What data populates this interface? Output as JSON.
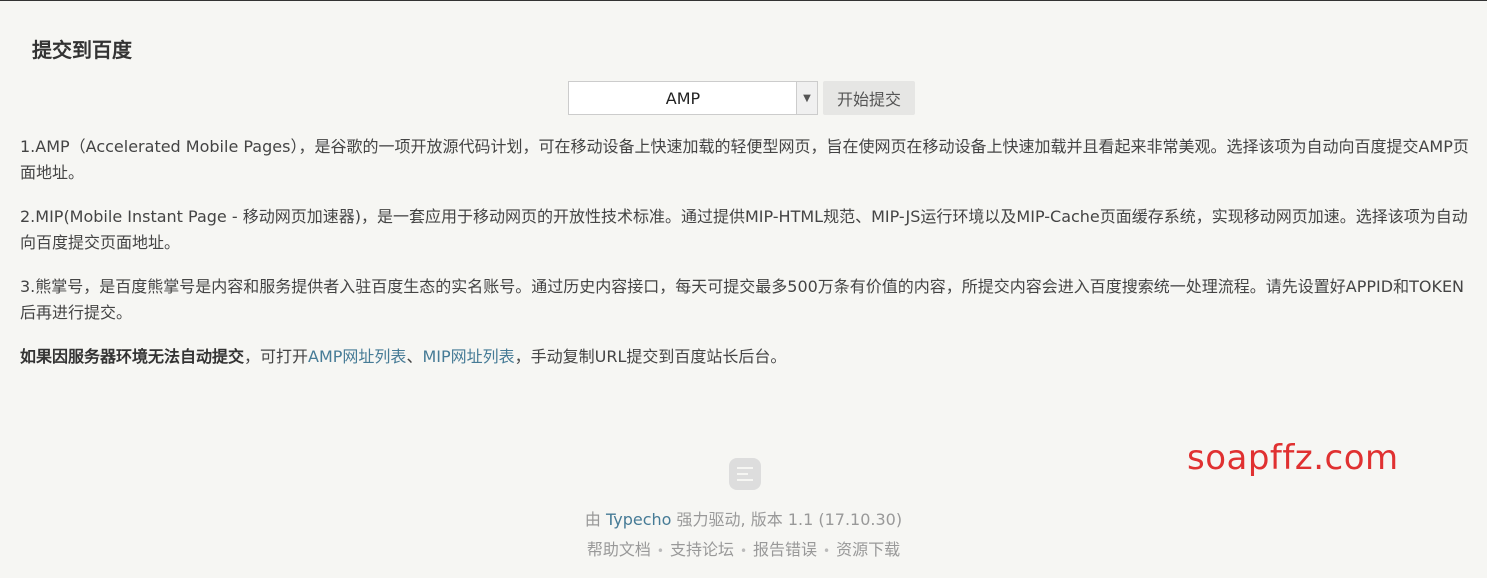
{
  "page": {
    "title": "提交到百度"
  },
  "form": {
    "selected_type": "AMP",
    "submit_label": "开始提交"
  },
  "content": {
    "p1": "1.AMP（Accelerated Mobile Pages），是谷歌的一项开放源代码计划，可在移动设备上快速加载的轻便型网页，旨在使网页在移动设备上快速加载并且看起来非常美观。选择该项为自动向百度提交AMP页面地址。",
    "p2": "2.MIP(Mobile Instant Page - 移动网页加速器)，是一套应用于移动网页的开放性技术标准。通过提供MIP-HTML规范、MIP-JS运行环境以及MIP-Cache页面缓存系统，实现移动网页加速。选择该项为自动向百度提交页面地址。",
    "p3": "3.熊掌号，是百度熊掌号是内容和服务提供者入驻百度生态的实名账号。通过历史内容接口，每天可提交最多500万条有价值的内容，所提交内容会进入百度搜索统一处理流程。请先设置好APPID和TOKEN后再进行提交。",
    "note_bold": "如果因服务器环境无法自动提交",
    "note_mid": "，可打开",
    "amp_link": "AMP网址列表",
    "note_sep": "、",
    "mip_link": "MIP网址列表",
    "note_end": "，手动复制URL提交到百度站长后台。"
  },
  "watermark": "soapffz.com",
  "footer": {
    "powered_prefix": "由 ",
    "powered_link": "Typecho",
    "powered_suffix": " 强力驱动, 版本 1.1 (17.10.30)",
    "links": [
      "帮助文档",
      "支持论坛",
      "报告错误",
      "资源下载"
    ],
    "separator": "•"
  }
}
